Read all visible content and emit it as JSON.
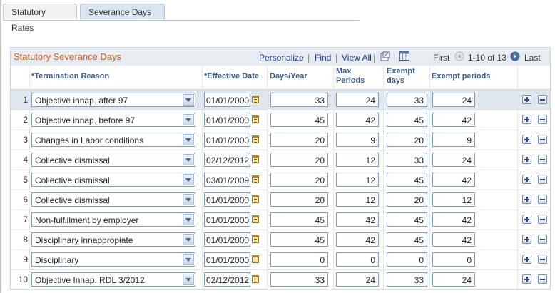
{
  "tabs": [
    {
      "label": "Statutory Rates",
      "active": false
    },
    {
      "label": "Severance Days",
      "active": true
    }
  ],
  "grid": {
    "title": "Statutory Severance Days",
    "personalize": "Personalize",
    "find": "Find",
    "view_all": "View All",
    "first": "First",
    "range": "1-10 of 13",
    "last": "Last",
    "columns": {
      "reason": "*Termination Reason",
      "effdate": "*Effective Date",
      "days_year": "Days/Year",
      "max_periods": "Max Periods",
      "exempt_days": "Exempt days",
      "exempt_periods": "Exempt periods"
    }
  },
  "rows": [
    {
      "num": "1",
      "reason": "Objective innap. after 97",
      "date": "01/01/2000",
      "days_year": "33",
      "max_periods": "24",
      "exempt_days": "33",
      "exempt_periods": "24"
    },
    {
      "num": "2",
      "reason": "Objective innap. before 97",
      "date": "01/01/2000",
      "days_year": "45",
      "max_periods": "42",
      "exempt_days": "45",
      "exempt_periods": "42"
    },
    {
      "num": "3",
      "reason": "Changes in Labor conditions",
      "date": "01/01/2000",
      "days_year": "20",
      "max_periods": "9",
      "exempt_days": "20",
      "exempt_periods": "9"
    },
    {
      "num": "4",
      "reason": "Collective dismissal",
      "date": "02/12/2012",
      "days_year": "20",
      "max_periods": "12",
      "exempt_days": "33",
      "exempt_periods": "24"
    },
    {
      "num": "5",
      "reason": "Collective dismissal",
      "date": "03/01/2009",
      "days_year": "20",
      "max_periods": "12",
      "exempt_days": "45",
      "exempt_periods": "42"
    },
    {
      "num": "6",
      "reason": "Collective dismissal",
      "date": "01/01/2000",
      "days_year": "20",
      "max_periods": "12",
      "exempt_days": "20",
      "exempt_periods": "12"
    },
    {
      "num": "7",
      "reason": "Non-fulfillment by employer",
      "date": "01/01/2000",
      "days_year": "45",
      "max_periods": "42",
      "exempt_days": "45",
      "exempt_periods": "42"
    },
    {
      "num": "8",
      "reason": "Disciplinary innappropiate",
      "date": "01/01/2000",
      "days_year": "45",
      "max_periods": "42",
      "exempt_days": "45",
      "exempt_periods": "42"
    },
    {
      "num": "9",
      "reason": "Disciplinary",
      "date": "01/01/2000",
      "days_year": "0",
      "max_periods": "0",
      "exempt_days": "0",
      "exempt_periods": "0"
    },
    {
      "num": "10",
      "reason": "Objective Innap. RDL 3/2012",
      "date": "02/12/2012",
      "days_year": "33",
      "max_periods": "24",
      "exempt_days": "33",
      "exempt_periods": "24"
    }
  ],
  "colors": {
    "title": "#cc5e1c",
    "header_bg": "#e6ecf2",
    "selected_row": "#dfe6ed",
    "link": "#1a3a8a"
  }
}
